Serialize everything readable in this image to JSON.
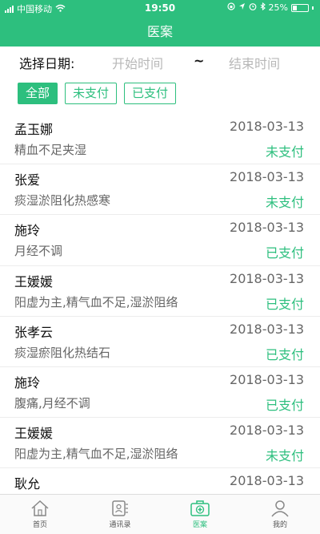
{
  "status_bar": {
    "carrier": "中国移动",
    "time": "19:50",
    "battery": "25%"
  },
  "header": {
    "title": "医案"
  },
  "date_filter": {
    "label": "选择日期:",
    "start_placeholder": "开始时间",
    "separator": "~",
    "end_placeholder": "结束时间"
  },
  "filters": [
    {
      "label": "全部",
      "active": true
    },
    {
      "label": "未支付",
      "active": false
    },
    {
      "label": "已支付",
      "active": false
    }
  ],
  "records": [
    {
      "name": "孟玉娜",
      "date": "2018-03-13",
      "diagnosis": "精血不足夹湿",
      "status": "未支付"
    },
    {
      "name": "张爱",
      "date": "2018-03-13",
      "diagnosis": "痰湿淤阻化热感寒",
      "status": "未支付"
    },
    {
      "name": "施玲",
      "date": "2018-03-13",
      "diagnosis": "月经不调",
      "status": "已支付"
    },
    {
      "name": "王媛媛",
      "date": "2018-03-13",
      "diagnosis": "阳虚为主,精气血不足,湿淤阻络",
      "status": "已支付"
    },
    {
      "name": "张孝云",
      "date": "2018-03-13",
      "diagnosis": "痰湿瘀阻化热结石",
      "status": "已支付"
    },
    {
      "name": "施玲",
      "date": "2018-03-13",
      "diagnosis": "腹痛,月经不调",
      "status": "已支付"
    },
    {
      "name": "王媛媛",
      "date": "2018-03-13",
      "diagnosis": "阳虚为主,精气血不足,湿淤阻络",
      "status": "未支付"
    },
    {
      "name": "耿允",
      "date": "2018-03-13",
      "diagnosis": "",
      "status": ""
    }
  ],
  "tabbar": [
    {
      "label": "首页",
      "icon": "home-icon",
      "active": false
    },
    {
      "label": "通讯录",
      "icon": "contacts-icon",
      "active": false
    },
    {
      "label": "医案",
      "icon": "medical-case-icon",
      "active": true
    },
    {
      "label": "我的",
      "icon": "profile-icon",
      "active": false
    }
  ],
  "colors": {
    "accent": "#2dbf7e"
  }
}
